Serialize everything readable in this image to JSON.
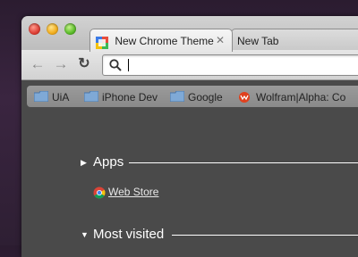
{
  "window": {
    "tabs": [
      {
        "title": "New Chrome Theme",
        "icon": "google-docs-icon",
        "active": true
      },
      {
        "title": "New Tab",
        "icon": "",
        "active": false
      }
    ],
    "close_glyph": "✕"
  },
  "toolbar": {
    "back_glyph": "←",
    "forward_glyph": "→",
    "reload_glyph": "↻",
    "omnibox_value": ""
  },
  "bookmarks": [
    {
      "label": "UiA",
      "icon": "folder-icon"
    },
    {
      "label": "iPhone Dev",
      "icon": "folder-icon"
    },
    {
      "label": "Google",
      "icon": "folder-icon"
    },
    {
      "label": "Wolfram|Alpha: Co",
      "icon": "wolfram-icon"
    }
  ],
  "ntp": {
    "apps_label": "Apps",
    "apps_arrow": "▶",
    "webstore_label": "Web Store",
    "most_visited_label": "Most visited",
    "most_visited_arrow": "▼"
  },
  "colors": {
    "desktop": "#2e1f33",
    "ntp_background": "#4a4a4a",
    "bookmark_bar": "#8e8e8e"
  }
}
